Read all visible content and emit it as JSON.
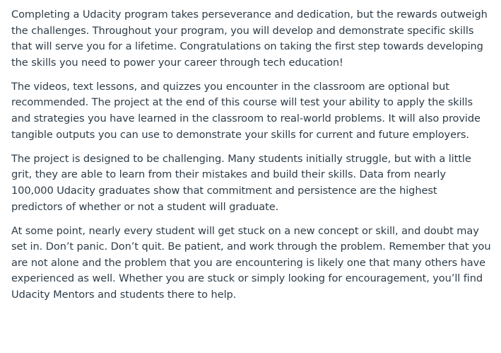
{
  "article": {
    "paragraphs": [
      "Completing a Udacity program takes perseverance and dedication, but the rewards outweigh the challenges. Throughout your program, you will develop and demonstrate specific skills that will serve you for a lifetime. Congratulations on taking the first step towards developing the skills you need to power your career through tech education!",
      "The videos, text lessons, and quizzes you encounter in the classroom are optional but recommended. The project at the end of this course will test your ability to apply the skills and strategies you have learned in the classroom to real-world problems. It will also provide tangible outputs you can use to demonstrate your skills for current and future employers.",
      "The project is designed to be challenging. Many students initially struggle, but with a little grit, they are able to learn from their mistakes and build their skills. Data from nearly 100,000 Udacity graduates show that commitment and persistence are the highest predictors of whether or not a student will graduate.",
      "At some point, nearly every student will get stuck on a new concept or skill, and doubt may set in. Don’t panic. Don’t quit. Be patient, and work through the problem. Remember that you are not alone and the problem that you are encountering is likely one that many others have experienced as well. Whether you are stuck or simply looking for encouragement, you’ll find Udacity Mentors and students there to help."
    ]
  }
}
